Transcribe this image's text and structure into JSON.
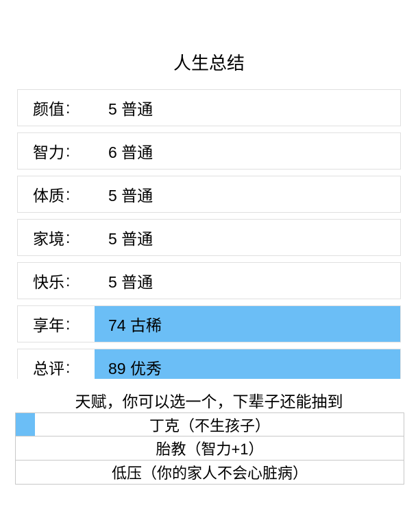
{
  "title": "人生总结",
  "stats": [
    {
      "label": "颜值",
      "value": "5 普通",
      "highlight": false
    },
    {
      "label": "智力",
      "value": "6 普通",
      "highlight": false
    },
    {
      "label": "体质",
      "value": "5 普通",
      "highlight": false
    },
    {
      "label": "家境",
      "value": "5 普通",
      "highlight": false
    },
    {
      "label": "快乐",
      "value": "5 普通",
      "highlight": false
    },
    {
      "label": "享年",
      "value": "74 古稀",
      "highlight": true
    },
    {
      "label": "总评",
      "value": "89 优秀",
      "highlight": true
    }
  ],
  "talents_header": "天赋，你可以选一个，下辈子还能抽到",
  "talents": [
    {
      "name": "丁克（不生孩子）",
      "selected": true
    },
    {
      "name": "胎教（智力+1）",
      "selected": false
    },
    {
      "name": "低压（你的家人不会心脏病）",
      "selected": false
    }
  ]
}
